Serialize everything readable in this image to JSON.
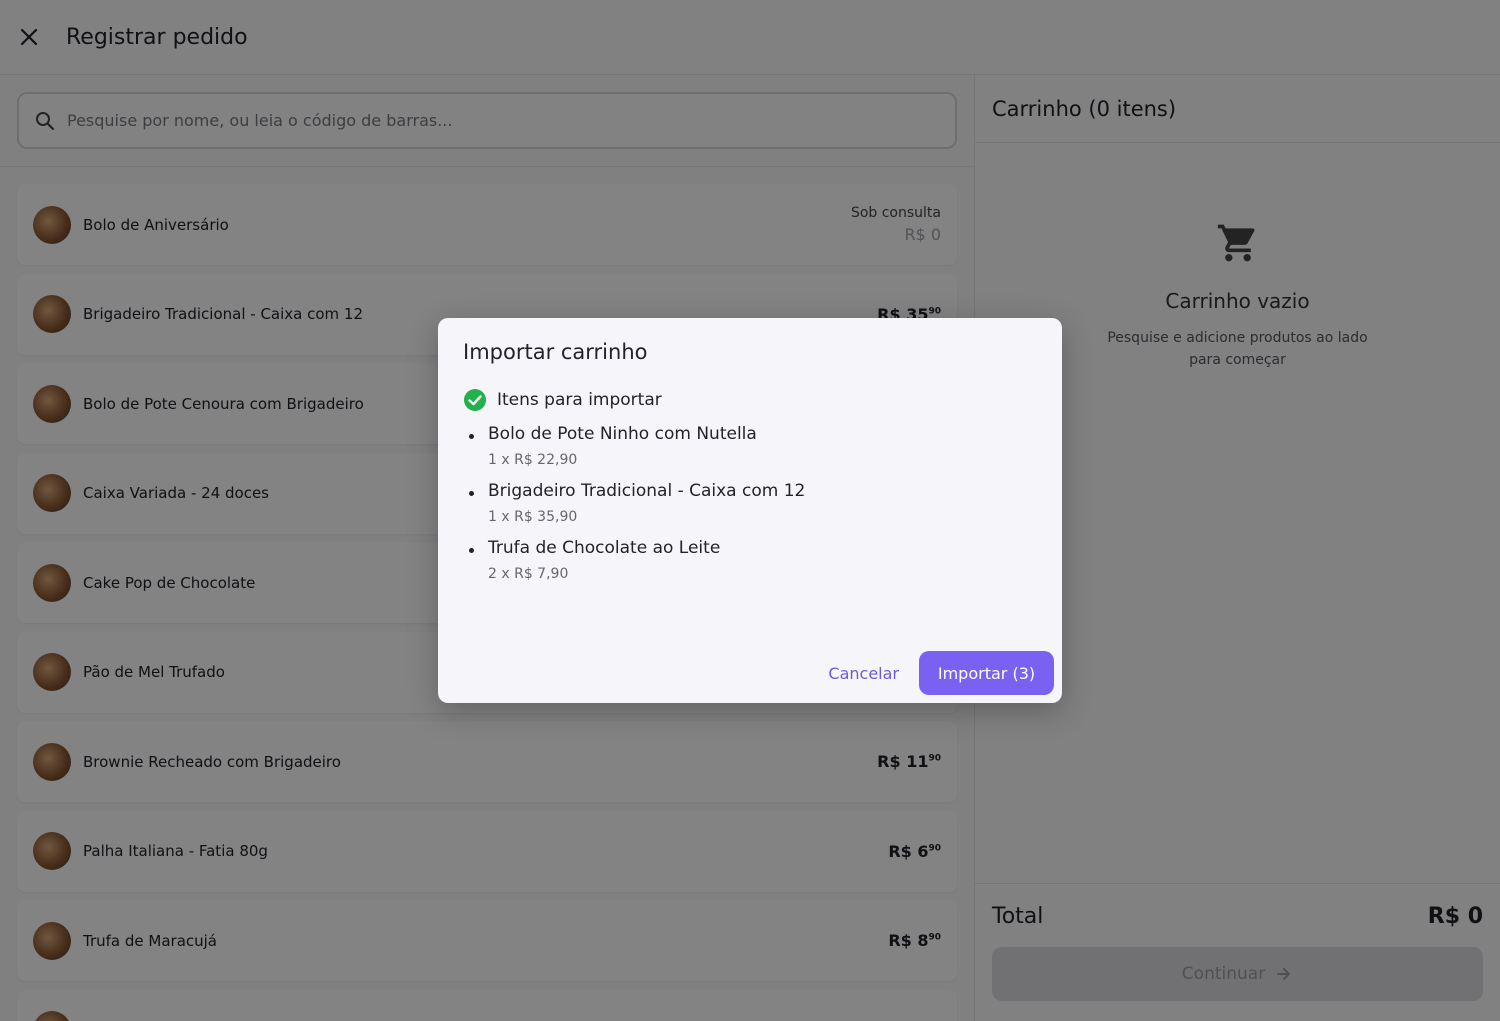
{
  "header": {
    "title": "Registrar pedido",
    "close_icon": "close-icon"
  },
  "search": {
    "placeholder": "Pesquise por nome, ou leia o código de barras..."
  },
  "products": [
    {
      "name": "Bolo de Aniversário",
      "price_label": "Sob consulta",
      "price_sub": "R$ 0"
    },
    {
      "name": "Brigadeiro Tradicional - Caixa com 12",
      "price_int": "R$ 35",
      "price_cents": "90"
    },
    {
      "name": "Bolo de Pote Cenoura com Brigadeiro"
    },
    {
      "name": "Caixa Variada - 24 doces"
    },
    {
      "name": "Cake Pop de Chocolate"
    },
    {
      "name": "Pão de Mel Trufado"
    },
    {
      "name": "Brownie Recheado com Brigadeiro",
      "price_int": "R$ 11",
      "price_cents": "90"
    },
    {
      "name": "Palha Italiana - Fatia 80g",
      "price_int": "R$ 6",
      "price_cents": "90"
    },
    {
      "name": "Trufa de Maracujá",
      "price_int": "R$ 8",
      "price_cents": "90"
    }
  ],
  "cart": {
    "header": "Carrinho (0 itens)",
    "empty_icon": "cart-icon",
    "empty_title": "Carrinho vazio",
    "empty_subtitle": "Pesquise e adicione produtos ao lado para começar",
    "total_label": "Total",
    "total_value": "R$ 0",
    "continue_label": "Continuar"
  },
  "modal": {
    "title": "Importar carrinho",
    "section_label": "Itens para importar",
    "items": [
      {
        "name": "Bolo de Pote Ninho com Nutella",
        "detail": "1 x R$ 22,90"
      },
      {
        "name": "Brigadeiro Tradicional - Caixa com 12",
        "detail": "1 x R$ 35,90"
      },
      {
        "name": "Trufa de Chocolate ao Leite",
        "detail": "2 x R$ 7,90"
      }
    ],
    "cancel_label": "Cancelar",
    "import_label": "Importar (3)"
  },
  "colors": {
    "accent": "#7b61f2",
    "success": "#22b14c",
    "overlay": "rgba(0,0,0,0.48)"
  }
}
